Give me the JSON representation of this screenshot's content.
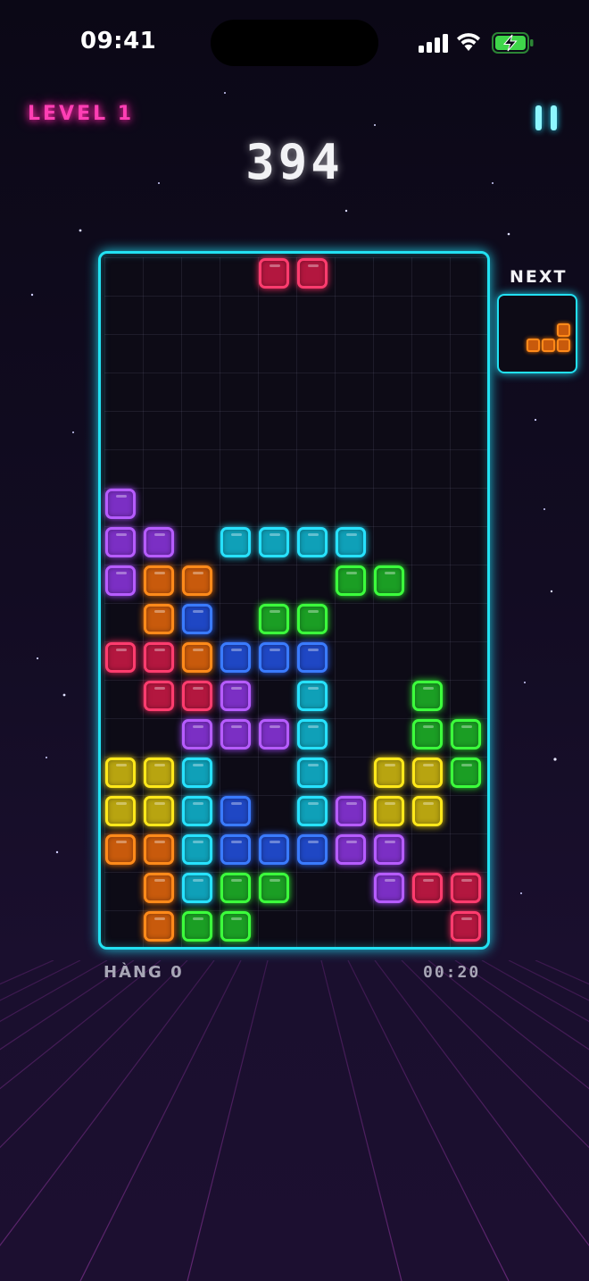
{
  "status_bar": {
    "time": "09:41"
  },
  "hud": {
    "level": "LEVEL 1",
    "score": "394",
    "next_label": "NEXT",
    "lines": "HÀNG 0",
    "timer": "00:20"
  },
  "colors": {
    "R": {
      "border": "#ff3c6e",
      "fill": "#b3173f",
      "glow": "#ff2a5e"
    },
    "P": {
      "border": "#b65cff",
      "fill": "#7b2fc4",
      "glow": "#a64bff"
    },
    "C": {
      "border": "#27e2ff",
      "fill": "#0fa0b8",
      "glow": "#1fd6f0"
    },
    "O": {
      "border": "#ff8a1a",
      "fill": "#c85a0c",
      "glow": "#ff7a00"
    },
    "G": {
      "border": "#3cff3c",
      "fill": "#1b9e24",
      "glow": "#2ef02e"
    },
    "B": {
      "border": "#3a7bff",
      "fill": "#1f47c4",
      "glow": "#2f6bff"
    },
    "Y": {
      "border": "#ffe81a",
      "fill": "#b8a410",
      "glow": "#f5dc0a"
    }
  },
  "board": {
    "columns": 10,
    "rows": 18,
    "grid": [
      "....RR....",
      "..........",
      "..........",
      "..........",
      "..........",
      "..........",
      "P.........",
      "PP.CCCC...",
      "POO...GG..",
      ".OB.GG....",
      "RROBBB....",
      ".RRP.C..G.",
      "..PPPC..GG",
      "YYC..C.YYG",
      "YYCB.CPYY.",
      "OOCBBBPP..",
      ".OCGG..PRR",
      ".OGG.....R"
    ]
  },
  "next_piece": {
    "type": "L",
    "color": "O",
    "grid": [
      "..O",
      "OOO"
    ]
  }
}
